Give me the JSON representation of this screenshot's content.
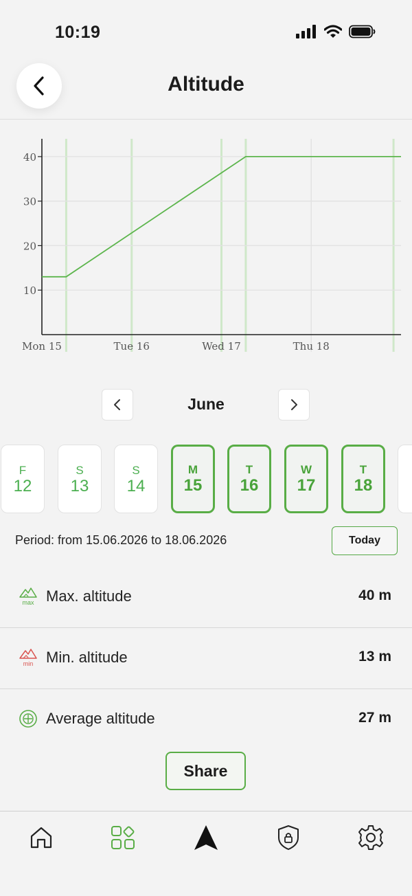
{
  "status_bar": {
    "time": "10:19"
  },
  "header": {
    "title": "Altitude"
  },
  "chart_data": {
    "type": "line",
    "title": "",
    "xlabel": "",
    "ylabel": "",
    "x_tick_labels": [
      "Mon 15",
      "Tue 16",
      "Wed 17",
      "Thu 18"
    ],
    "y_ticks": [
      10,
      20,
      30,
      40
    ],
    "ylim": [
      0,
      44
    ],
    "grid": true,
    "color": "#5cb54c",
    "series": [
      {
        "points": [
          {
            "x": "2026-06-15 00:00",
            "y": 13
          },
          {
            "x": "2026-06-15 06:30",
            "y": 13
          },
          {
            "x": "2026-06-17 06:30",
            "y": 40
          },
          {
            "x": "2026-06-19 00:00",
            "y": 40
          }
        ]
      }
    ]
  },
  "month_nav": {
    "month": "June"
  },
  "days": [
    {
      "letter": "F",
      "num": "12",
      "selected": false
    },
    {
      "letter": "S",
      "num": "13",
      "selected": false
    },
    {
      "letter": "S",
      "num": "14",
      "selected": false
    },
    {
      "letter": "M",
      "num": "15",
      "selected": true
    },
    {
      "letter": "T",
      "num": "16",
      "selected": true
    },
    {
      "letter": "W",
      "num": "17",
      "selected": true
    },
    {
      "letter": "T",
      "num": "18",
      "selected": true
    }
  ],
  "period": {
    "text": "Period: from 15.06.2026 to 18.06.2026",
    "today_label": "Today"
  },
  "stats": [
    {
      "icon": "max-altitude-icon",
      "icon_text": "max",
      "label": "Max. altitude",
      "value": "40 m"
    },
    {
      "icon": "min-altitude-icon",
      "icon_text": "min",
      "label": "Min. altitude",
      "value": "13 m"
    },
    {
      "icon": "average-altitude-icon",
      "label": "Average altitude",
      "value": "27 m"
    }
  ],
  "share_label": "Share",
  "bottom_nav": [
    "home-icon",
    "apps-icon",
    "navigation-icon",
    "security-icon",
    "settings-icon"
  ],
  "colors": {
    "accent": "#59ad46",
    "min": "#d9534f"
  }
}
